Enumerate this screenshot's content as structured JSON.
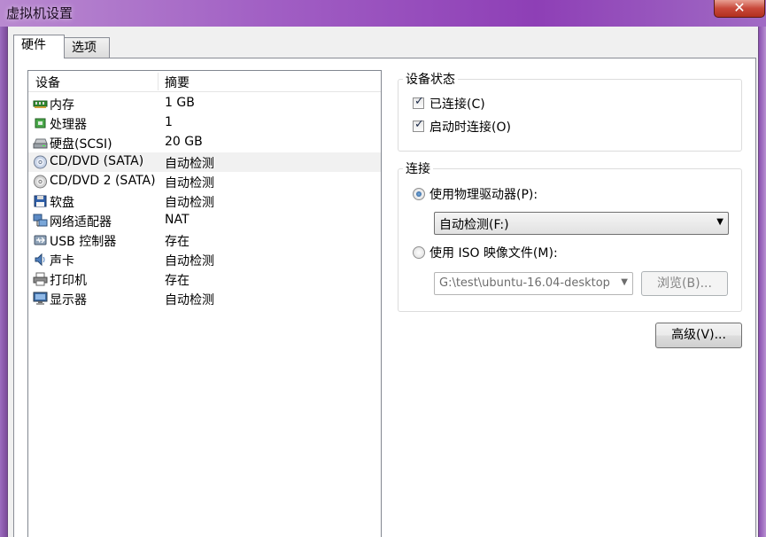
{
  "window": {
    "title": "虚拟机设置",
    "close_glyph": "✕"
  },
  "tabs": [
    {
      "label": "硬件"
    },
    {
      "label": "选项"
    }
  ],
  "device_list": {
    "columns": {
      "device": "设备",
      "summary": "摘要"
    },
    "rows": [
      {
        "name": "内存",
        "summary": "1 GB",
        "icon": "memory-icon"
      },
      {
        "name": "处理器",
        "summary": "1",
        "icon": "processor-icon"
      },
      {
        "name": "硬盘(SCSI)",
        "summary": "20 GB",
        "icon": "harddisk-icon"
      },
      {
        "name": "CD/DVD (SATA)",
        "summary": "自动检测",
        "icon": "cd-dvd-icon",
        "selected": true
      },
      {
        "name": "CD/DVD 2 (SATA)",
        "summary": "自动检测",
        "icon": "cd-dvd-icon"
      },
      {
        "name": "软盘",
        "summary": "自动检测",
        "icon": "floppy-icon"
      },
      {
        "name": "网络适配器",
        "summary": "NAT",
        "icon": "network-adapter-icon"
      },
      {
        "name": "USB 控制器",
        "summary": "存在",
        "icon": "usb-icon"
      },
      {
        "name": "声卡",
        "summary": "自动检测",
        "icon": "sound-card-icon"
      },
      {
        "name": "打印机",
        "summary": "存在",
        "icon": "printer-icon"
      },
      {
        "name": "显示器",
        "summary": "自动检测",
        "icon": "display-icon"
      }
    ]
  },
  "device_status": {
    "title": "设备状态",
    "connected": {
      "label": "已连接(C)",
      "checked": true
    },
    "connect_at_power_on": {
      "label": "启动时连接(O)",
      "checked": true
    }
  },
  "connection": {
    "title": "连接",
    "physical_drive": {
      "label": "使用物理驱动器(P):",
      "selected": true,
      "value": "自动检测(F:)"
    },
    "iso_image": {
      "label": "使用 ISO 映像文件(M):",
      "selected": false,
      "value": "G:\\test\\ubuntu-16.04-desktop"
    },
    "browse_label": "浏览(B)..."
  },
  "advanced_label": "高级(V)...",
  "colors": {
    "titlebar": "#a15fc4",
    "selection": "#f1f1f1",
    "close_button": "#c8483a"
  }
}
